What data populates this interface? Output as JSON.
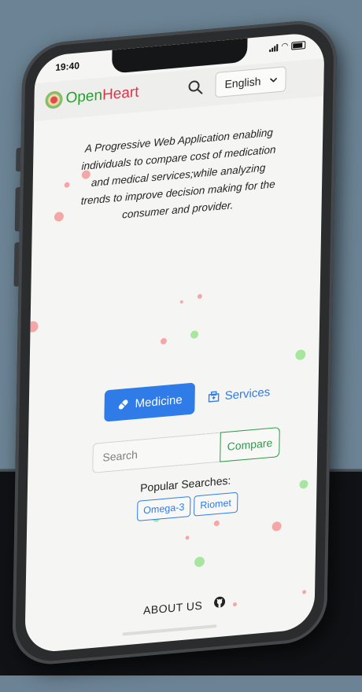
{
  "status_bar": {
    "time": "19:40"
  },
  "brand": {
    "open": "Open",
    "heart": "Heart"
  },
  "language": {
    "selected": "English"
  },
  "tagline": "A Progressive Web Application enabling individuals to compare cost of medication and medical services;while analyzing trends to improve decision making for the consumer and provider.",
  "tabs": {
    "medicine": "Medicine",
    "services": "Services"
  },
  "search": {
    "placeholder": "Search",
    "compare_label": "Compare"
  },
  "popular": {
    "heading": "Popular Searches:",
    "items": [
      "Omega-3",
      "Riomet"
    ]
  },
  "footer": {
    "about": "ABOUT US"
  },
  "colors": {
    "primary": "#2f7be8",
    "success": "#2f9a4a",
    "brand_green": "#23a02a",
    "brand_red": "#e0334a",
    "dot_red": "#f4a7a7",
    "dot_green": "#a8e6a0"
  },
  "icons": [
    "search-icon",
    "chevron-down-icon",
    "pill-icon",
    "hospital-icon",
    "github-icon"
  ]
}
